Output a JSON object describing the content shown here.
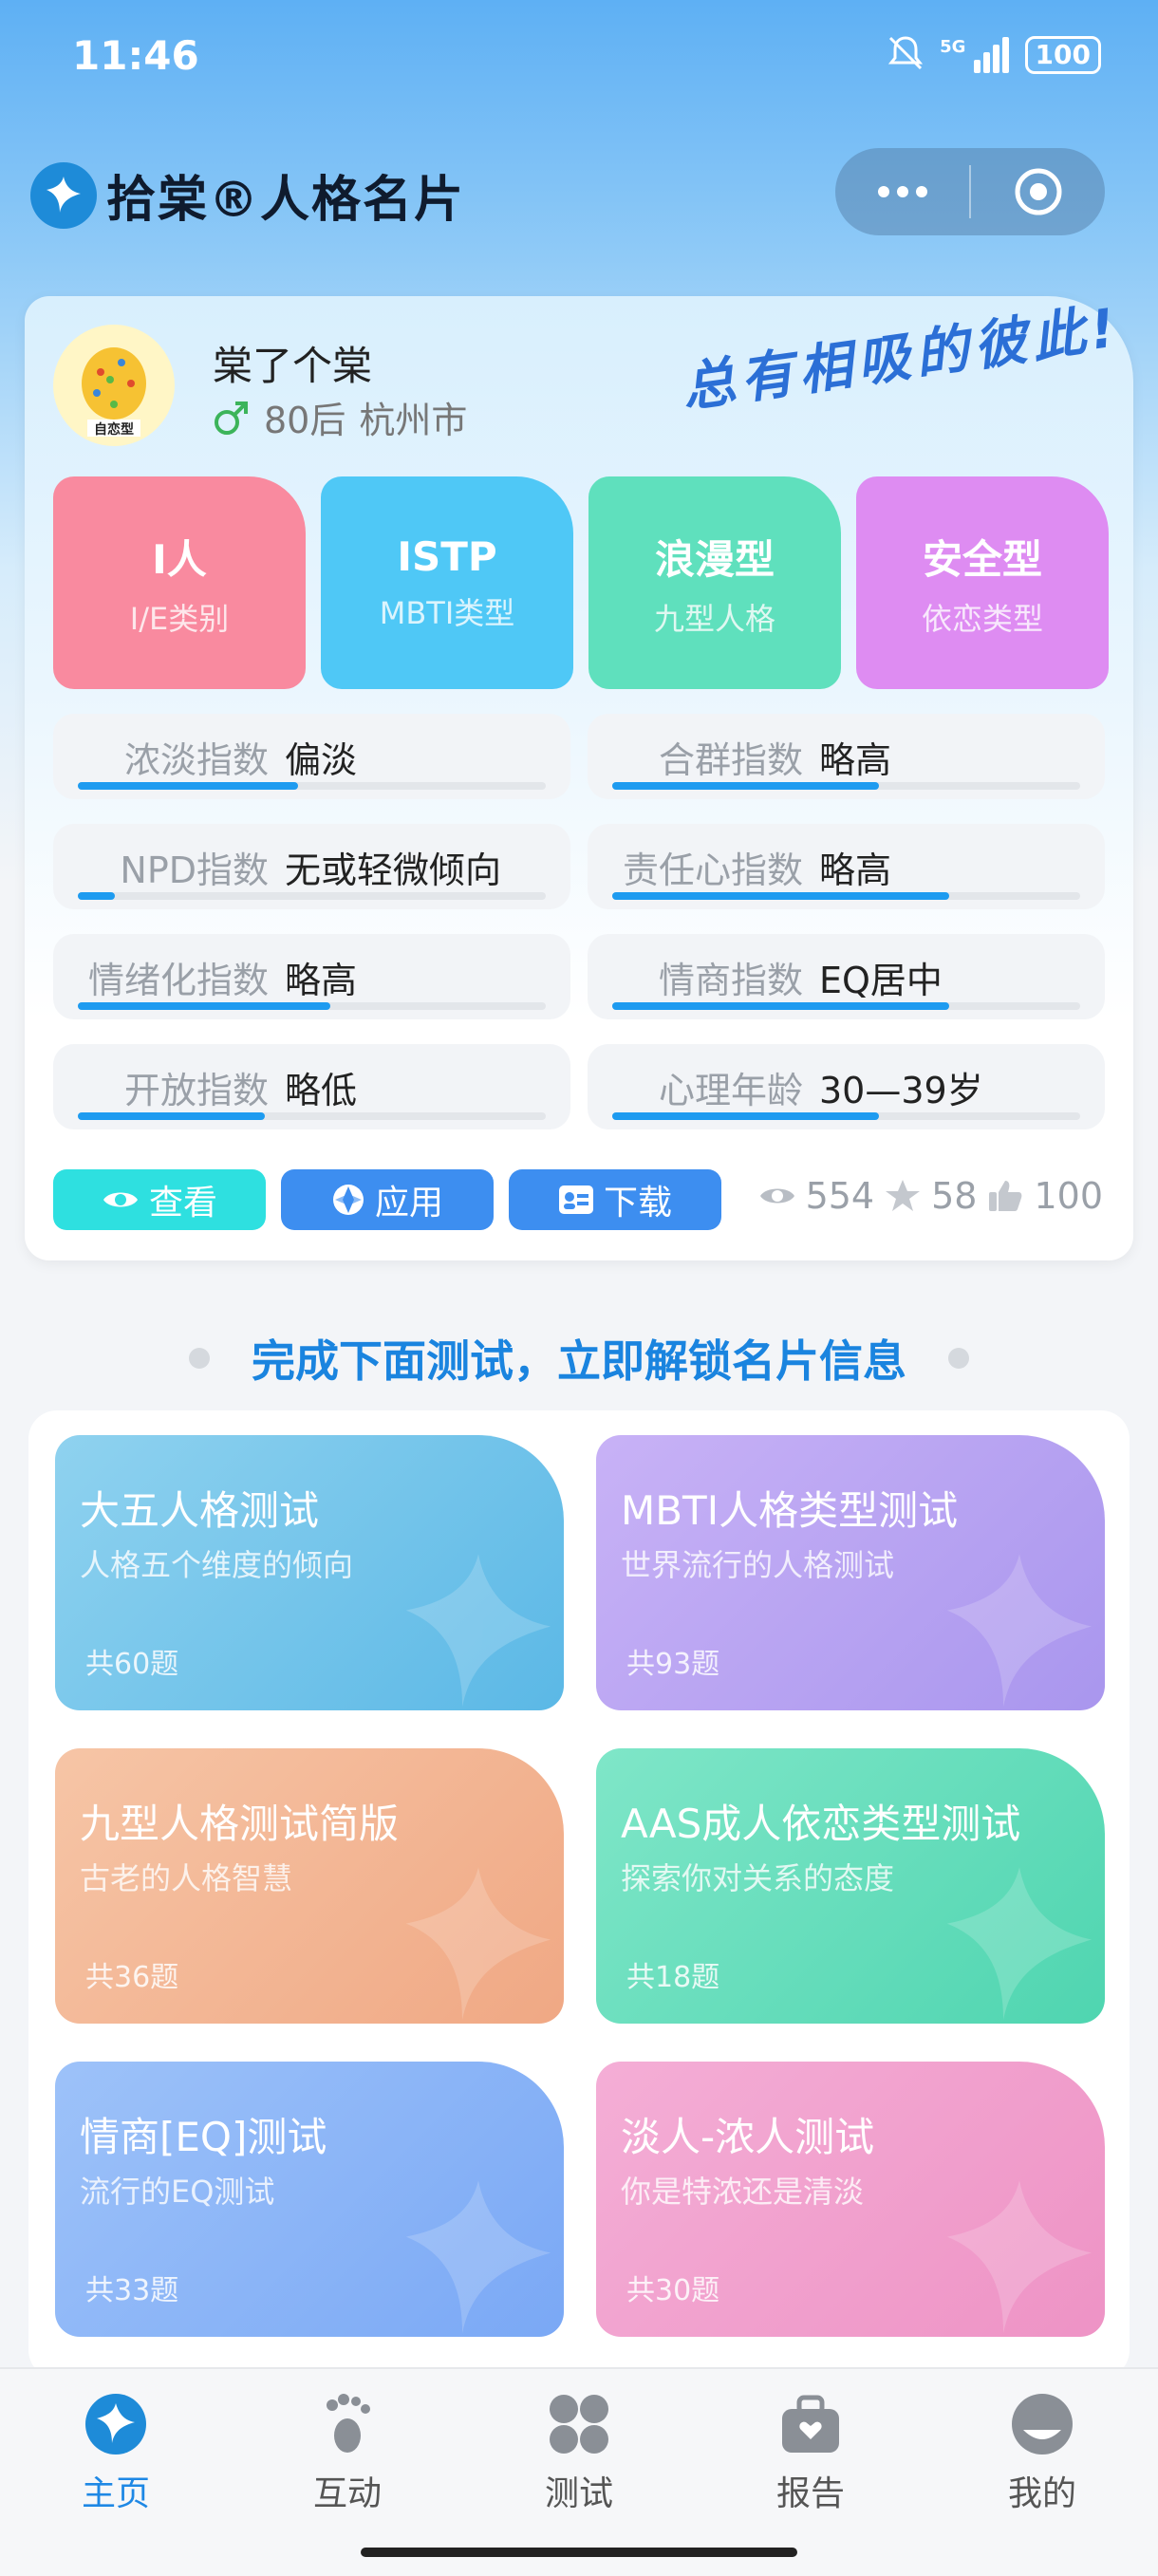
{
  "status_bar": {
    "time": "11:46",
    "network": "5G",
    "battery": "100"
  },
  "header": {
    "title": "拾棠®人格名片"
  },
  "profile": {
    "name": "棠了个棠",
    "gender_icon": "male-icon",
    "generation": "80后",
    "city": "杭州市",
    "avatar_caption": "自恋型",
    "slogan": "总有相吸的彼此!"
  },
  "tags": [
    {
      "main": "I人",
      "sub": "I/E类别",
      "color": "#f98a9f"
    },
    {
      "main": "ISTP",
      "sub": "MBTI类型",
      "color": "#4fc8f6"
    },
    {
      "main": "浪漫型",
      "sub": "九型人格",
      "color": "#5fe0bd"
    },
    {
      "main": "安全型",
      "sub": "依恋类型",
      "color": "#de8cf2"
    }
  ],
  "metrics": [
    {
      "label": "浓淡指数",
      "value": "偏淡",
      "level": 0.47
    },
    {
      "label": "合群指数",
      "value": "略高",
      "level": 0.57
    },
    {
      "label": "NPD指数",
      "value": "无或轻微倾向",
      "level": 0.08
    },
    {
      "label": "责任心指数",
      "value": "略高",
      "level": 0.72
    },
    {
      "label": "情绪化指数",
      "value": "略高",
      "level": 0.54
    },
    {
      "label": "情商指数",
      "value": "EQ居中",
      "level": 0.72
    },
    {
      "label": "开放指数",
      "value": "略低",
      "level": 0.4
    },
    {
      "label": "心理年龄",
      "value": "30—39岁",
      "level": 0.57
    }
  ],
  "actions": {
    "view": "查看",
    "apply": "应用",
    "download": "下载"
  },
  "stats": {
    "views": "554",
    "stars": "58",
    "likes": "100"
  },
  "section_title": "完成下面测试，立即解锁名片信息",
  "tests": [
    {
      "title": "大五人格测试",
      "subtitle": "人格五个维度的倾向",
      "count": "共60题",
      "from": "#8fd2ef",
      "to": "#5bb8e6"
    },
    {
      "title": "MBTI人格类型测试",
      "subtitle": "世界流行的人格测试",
      "count": "共93题",
      "from": "#c8b2f6",
      "to": "#a996ee"
    },
    {
      "title": "九型人格测试简版",
      "subtitle": "古老的人格智慧",
      "count": "共36题",
      "from": "#f6c5a6",
      "to": "#f0a884"
    },
    {
      "title": "AAS成人依恋类型测试",
      "subtitle": "探索你对关系的态度",
      "count": "共18题",
      "from": "#7fe6c8",
      "to": "#4fd5b0"
    },
    {
      "title": "情商[EQ]测试",
      "subtitle": "流行的EQ测试",
      "count": "共33题",
      "from": "#9dc2f9",
      "to": "#7aa8f5"
    },
    {
      "title": "淡人-浓人测试",
      "subtitle": "你是特浓还是清淡",
      "count": "共30题",
      "from": "#f4aed6",
      "to": "#ee93c5"
    }
  ],
  "tabbar": [
    {
      "label": "主页",
      "icon": "home-logo-icon",
      "active": true
    },
    {
      "label": "互动",
      "icon": "footprint-icon",
      "active": false
    },
    {
      "label": "测试",
      "icon": "grid-icon",
      "active": false
    },
    {
      "label": "报告",
      "icon": "report-bag-icon",
      "active": false
    },
    {
      "label": "我的",
      "icon": "profile-face-icon",
      "active": false
    }
  ]
}
